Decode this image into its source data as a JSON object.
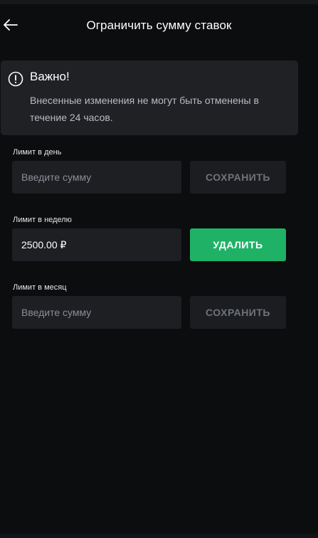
{
  "header": {
    "title": "Ограничить сумму ставок",
    "back_icon": "arrow-left-icon"
  },
  "notice": {
    "icon": "exclamation-circle-icon",
    "title": "Важно!",
    "text": "Внесенные изменения не могут быть отменены в течение 24 часов."
  },
  "limits": [
    {
      "label": "Лимит в день",
      "placeholder": "Введите сумму",
      "value": "",
      "button": "СОХРАНИТЬ"
    },
    {
      "label": "Лимит в неделю",
      "placeholder": "",
      "value": "2500.00 ₽",
      "button": "УДАЛИТЬ"
    },
    {
      "label": "Лимит в месяц",
      "placeholder": "Введите сумму",
      "value": "",
      "button": "СОХРАНИТЬ"
    }
  ],
  "colors": {
    "background": "#0c0d0f",
    "card": "#1f2125",
    "input": "#1d1f23",
    "accent_green": "#1fb266",
    "muted_text": "#8a8e95"
  }
}
